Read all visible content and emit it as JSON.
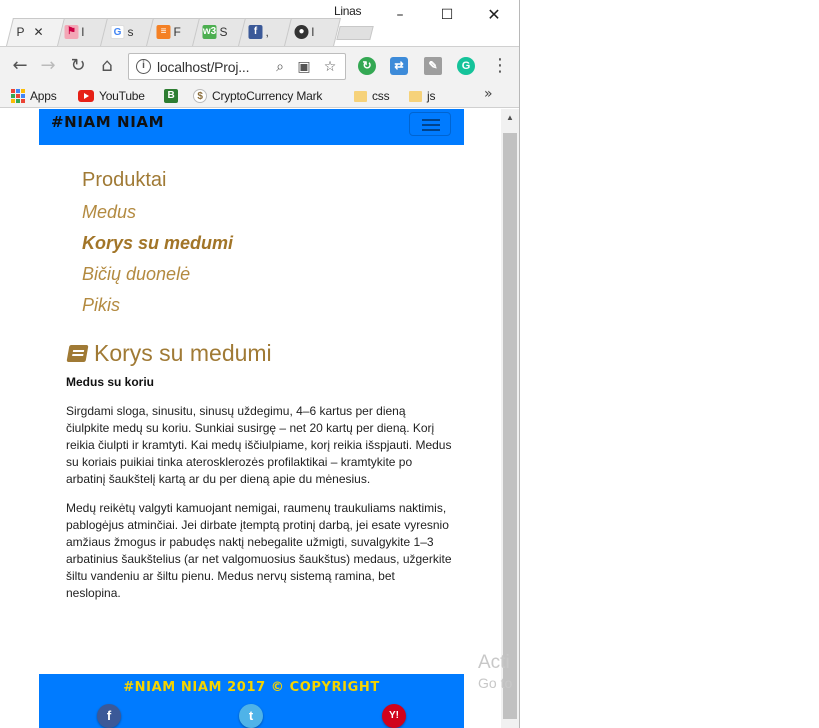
{
  "window": {
    "user": "Linas",
    "controls": {
      "minimize": "–",
      "maximize": "☐",
      "close": "✕"
    }
  },
  "tabs": [
    {
      "text": "P",
      "icon": "page-icon",
      "active": true,
      "close": "✕"
    },
    {
      "text": "l",
      "icon": "pink-flag-icon"
    },
    {
      "text": "s",
      "icon": "google-icon"
    },
    {
      "text": "F",
      "icon": "stackoverflow-icon"
    },
    {
      "text": "S",
      "icon": "w3schools-icon"
    },
    {
      "text": ",",
      "icon": "facebook-icon"
    },
    {
      "text": "l",
      "icon": "profile-icon"
    }
  ],
  "toolbar": {
    "url": "localhost/Proj...",
    "back": "←",
    "forward": "→",
    "reload": "↻",
    "home": "⌂",
    "menu": "⋮"
  },
  "bookmarks": [
    {
      "label": "Apps",
      "icon": "apps-grid-icon"
    },
    {
      "label": "YouTube",
      "icon": "youtube-icon"
    },
    {
      "label": "",
      "icon": "bitbucket-icon"
    },
    {
      "label": "CryptoCurrency Mark",
      "icon": "coin-icon"
    },
    {
      "label": "css",
      "icon": "folder-icon"
    },
    {
      "label": "js",
      "icon": "folder-icon"
    }
  ],
  "bookmarks_more": "»",
  "site": {
    "brand": "#NIAM NIAM",
    "nav_heading": "Produktai",
    "nav": [
      {
        "label": "Medus",
        "active": false
      },
      {
        "label": "Korys su medumi",
        "active": true
      },
      {
        "label": "Bičių duonelė",
        "active": false
      },
      {
        "label": "Pikis",
        "active": false
      }
    ],
    "article_title": "Korys su medumi",
    "article_subtitle": "Medus su koriu",
    "paragraphs": [
      "Sirgdami sloga, sinusitu, sinusų uždegimu, 4–6 kartus per dieną čiulpkite medų su koriu. Sunkiai susirgę – net 20 kartų per dieną. Korį reikia čiulpti ir kramtyti. Kai medų iščiulpiame, korį reikia išspjauti. Medus su koriais puikiai tinka aterosklerozės profilaktikai – kramtykite po arbatinį šaukštelį kartą ar du per dieną apie du mėnesius.",
      "Medų reikėtų valgyti kamuojant nemigai, raumenų traukuliams naktimis, pablogėjus atminčiai. Jei dirbate įtemptą protinį darbą, jei esate vyresnio amžiaus žmogus ir pabudęs naktį nebegalite užmigti, suvalgykite 1–3 arbatinius šaukštelius (ar net valgomuosius šaukštus) medaus, užgerkite šiltu vandeniu ar šiltu pienu. Medus nervų sistemą ramina, bet neslopina."
    ],
    "footer": "#NIAM NIAM 2017 © COPYRIGHT",
    "social": [
      {
        "name": "facebook-icon",
        "glyph": "f"
      },
      {
        "name": "twitter-icon",
        "glyph": "t"
      },
      {
        "name": "yahoo-icon",
        "glyph": "Y!"
      }
    ]
  },
  "watermark": {
    "line1": "Acti",
    "line2": "Go to"
  },
  "colors": {
    "header_blue": "#007bff",
    "accent_brown": "#a07a35",
    "footer_text": "#f5d400"
  }
}
